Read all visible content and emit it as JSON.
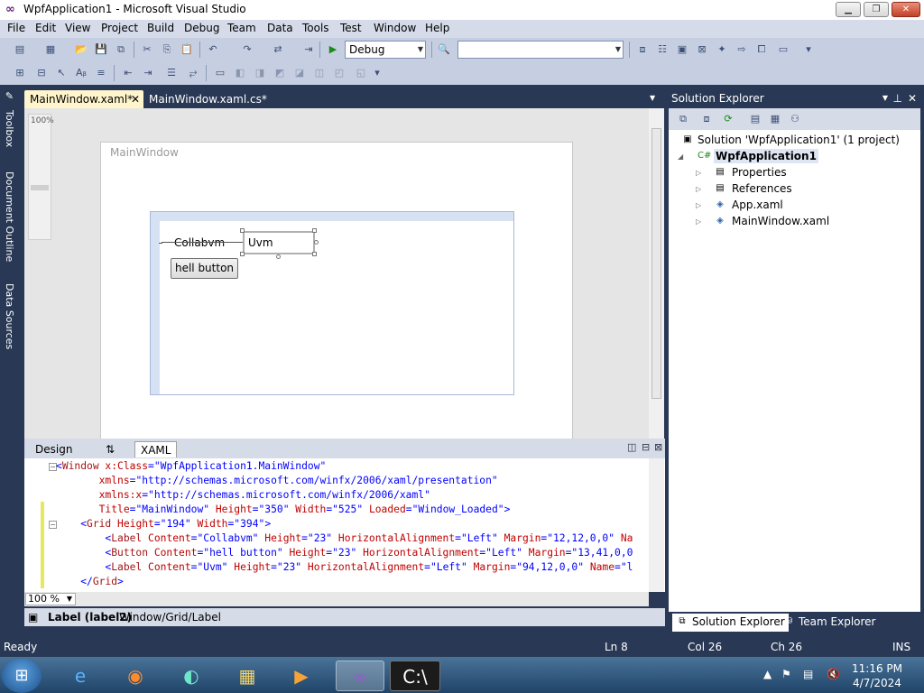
{
  "window": {
    "title": "WpfApplication1 - Microsoft Visual Studio",
    "controls": {
      "minimize": "▁",
      "maximize": "❐",
      "close": "✕"
    }
  },
  "menu": [
    "File",
    "Edit",
    "View",
    "Project",
    "Build",
    "Debug",
    "Team",
    "Data",
    "Tools",
    "Test",
    "Window",
    "Help"
  ],
  "toolbar": {
    "config_value": "Debug",
    "platform_value": "",
    "icons": [
      "new-project-icon",
      "add-item-icon",
      "open-icon",
      "save-icon",
      "save-all-icon",
      "cut-icon",
      "copy-icon",
      "paste-icon",
      "undo-icon",
      "redo-icon",
      "navigate-icon",
      "start-debugging-icon",
      "find-icon",
      "solution-explorer-icon",
      "properties-icon",
      "toolbox-icon",
      "start-page-icon"
    ]
  },
  "left_strip": {
    "toolbox": "Toolbox",
    "document_outline": "Document Outline",
    "data_sources": "Data Sources"
  },
  "tabs": {
    "active": "MainWindow.xaml*",
    "inactive": "MainWindow.xaml.cs*",
    "close": "✕"
  },
  "designer": {
    "zoom_label": "100%",
    "window_title": "MainWindow",
    "label_collab": "Collabvm",
    "label_uvm": "Uvm",
    "button": "hell button"
  },
  "view_tabs": {
    "design": "Design",
    "swap": "⇅",
    "xaml": "XAML"
  },
  "xaml": {
    "lines": [
      [
        [
          "<",
          "c-blue"
        ],
        [
          "Window",
          "c-brown"
        ],
        [
          " x:Class",
          "c-red"
        ],
        [
          "=",
          "c-blue"
        ],
        [
          "\"WpfApplication1.MainWindow\"",
          "c-blue"
        ]
      ],
      [
        [
          "       xmlns",
          "c-red"
        ],
        [
          "=",
          "c-blue"
        ],
        [
          "\"http://schemas.microsoft.com/winfx/2006/xaml/presentation\"",
          "c-blue"
        ]
      ],
      [
        [
          "       xmlns:x",
          "c-red"
        ],
        [
          "=",
          "c-blue"
        ],
        [
          "\"http://schemas.microsoft.com/winfx/2006/xaml\"",
          "c-blue"
        ]
      ],
      [
        [
          "       Title",
          "c-red"
        ],
        [
          "=",
          "c-blue"
        ],
        [
          "\"MainWindow\"",
          "c-blue"
        ],
        [
          " Height",
          "c-red"
        ],
        [
          "=",
          "c-blue"
        ],
        [
          "\"350\"",
          "c-blue"
        ],
        [
          " Width",
          "c-red"
        ],
        [
          "=",
          "c-blue"
        ],
        [
          "\"525\"",
          "c-blue"
        ],
        [
          " Loaded",
          "c-red"
        ],
        [
          "=",
          "c-blue"
        ],
        [
          "\"Window_Loaded\"",
          "c-blue"
        ],
        [
          ">",
          "c-blue"
        ]
      ],
      [
        [
          "    <",
          "c-blue"
        ],
        [
          "Grid",
          "c-brown"
        ],
        [
          " Height",
          "c-red"
        ],
        [
          "=",
          "c-blue"
        ],
        [
          "\"194\"",
          "c-blue"
        ],
        [
          " Width",
          "c-red"
        ],
        [
          "=",
          "c-blue"
        ],
        [
          "\"394\"",
          "c-blue"
        ],
        [
          ">",
          "c-blue"
        ]
      ],
      [
        [
          "        <",
          "c-blue"
        ],
        [
          "Label",
          "c-brown"
        ],
        [
          " Content",
          "c-red"
        ],
        [
          "=",
          "c-blue"
        ],
        [
          "\"Collabvm\"",
          "c-blue"
        ],
        [
          " Height",
          "c-red"
        ],
        [
          "=",
          "c-blue"
        ],
        [
          "\"23\"",
          "c-blue"
        ],
        [
          " HorizontalAlignment",
          "c-red"
        ],
        [
          "=",
          "c-blue"
        ],
        [
          "\"Left\"",
          "c-blue"
        ],
        [
          " Margin",
          "c-red"
        ],
        [
          "=",
          "c-blue"
        ],
        [
          "\"12,12,0,0\"",
          "c-blue"
        ],
        [
          " Na",
          "c-red"
        ]
      ],
      [
        [
          "        <",
          "c-blue"
        ],
        [
          "Button",
          "c-brown"
        ],
        [
          " Content",
          "c-red"
        ],
        [
          "=",
          "c-blue"
        ],
        [
          "\"hell button\"",
          "c-blue"
        ],
        [
          " Height",
          "c-red"
        ],
        [
          "=",
          "c-blue"
        ],
        [
          "\"23\"",
          "c-blue"
        ],
        [
          " HorizontalAlignment",
          "c-red"
        ],
        [
          "=",
          "c-blue"
        ],
        [
          "\"Left\"",
          "c-blue"
        ],
        [
          " Margin",
          "c-red"
        ],
        [
          "=",
          "c-blue"
        ],
        [
          "\"13,41,0,0",
          "c-blue"
        ]
      ],
      [
        [
          "        <",
          "c-blue"
        ],
        [
          "Label",
          "c-brown"
        ],
        [
          " Content",
          "c-red"
        ],
        [
          "=",
          "c-blue"
        ],
        [
          "\"Uvm\"",
          "c-blue"
        ],
        [
          " Height",
          "c-red"
        ],
        [
          "=",
          "c-blue"
        ],
        [
          "\"23\"",
          "c-blue"
        ],
        [
          " HorizontalAlignment",
          "c-red"
        ],
        [
          "=",
          "c-blue"
        ],
        [
          "\"Left\"",
          "c-blue"
        ],
        [
          " Margin",
          "c-red"
        ],
        [
          "=",
          "c-blue"
        ],
        [
          "\"94,12,0,0\"",
          "c-blue"
        ],
        [
          " Name",
          "c-red"
        ],
        [
          "=",
          "c-blue"
        ],
        [
          "\"l",
          "c-blue"
        ]
      ],
      [
        [
          "    </",
          "c-blue"
        ],
        [
          "Grid",
          "c-brown"
        ],
        [
          ">",
          "c-blue"
        ]
      ]
    ]
  },
  "editor_zoom": "100 %",
  "breadcrumb": {
    "element": "Label (label2)",
    "path": "Window/Grid/Label"
  },
  "solution_explorer": {
    "title": "Solution Explorer",
    "solution": "Solution 'WpfApplication1' (1 project)",
    "project": "WpfApplication1",
    "items": [
      "Properties",
      "References",
      "App.xaml",
      "MainWindow.xaml"
    ]
  },
  "bottom_tabs": {
    "solution_explorer": "Solution Explorer",
    "team_explorer": "Team Explorer"
  },
  "status": {
    "ready": "Ready",
    "ln": "Ln 8",
    "col": "Col 26",
    "ch": "Ch 26",
    "ins": "INS"
  },
  "taskbar": {
    "time": "11:16 PM",
    "date": "4/7/2024"
  },
  "colors": {
    "accent": "#293955",
    "tab_active": "#fff5cc",
    "menu": "#d6dbe9"
  }
}
